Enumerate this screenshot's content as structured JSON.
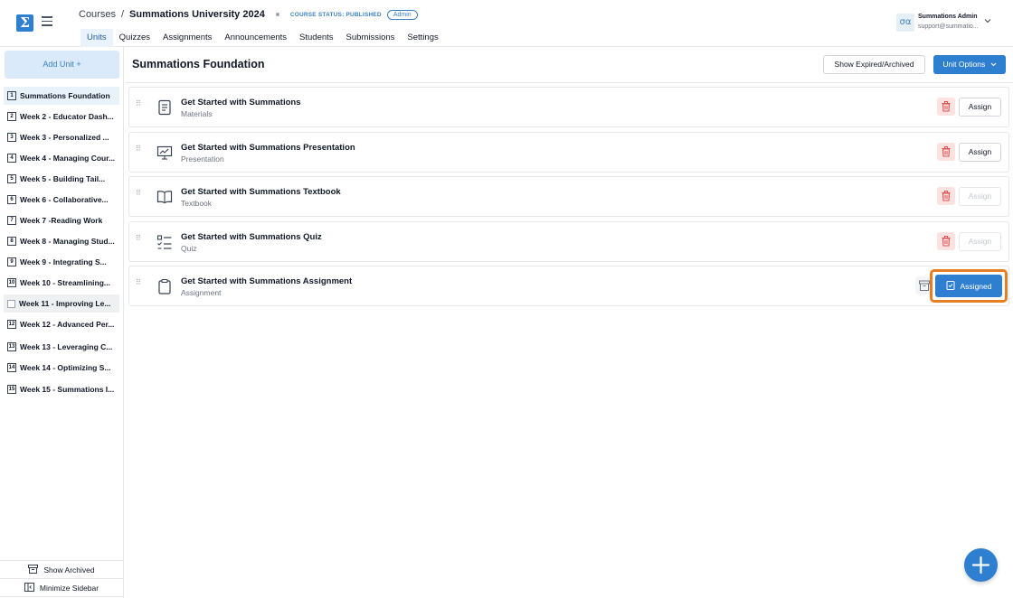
{
  "header": {
    "logo_glyph": "Σ",
    "breadcrumb": {
      "courses": "Courses",
      "separator": "/",
      "current": "Summations University 2024"
    },
    "course_status": "COURSE STATUS: PUBLISHED",
    "role_badge": "Admin",
    "tabs": [
      {
        "label": "Units",
        "active": true
      },
      {
        "label": "Quizzes",
        "active": false
      },
      {
        "label": "Assignments",
        "active": false
      },
      {
        "label": "Announcements",
        "active": false
      },
      {
        "label": "Students",
        "active": false
      },
      {
        "label": "Submissions",
        "active": false
      },
      {
        "label": "Settings",
        "active": false
      }
    ],
    "user": {
      "avatar_text": "σα",
      "name": "Summations Admin",
      "email": "support@summatio..."
    }
  },
  "sidebar": {
    "add_unit_label": "Add Unit +",
    "units": [
      {
        "num": "1",
        "label": "Summations Foundation"
      },
      {
        "num": "2",
        "label": "Week 2 - Educator Dash..."
      },
      {
        "num": "3",
        "label": "Week 3 - Personalized ..."
      },
      {
        "num": "4",
        "label": "Week 4 - Managing Cour..."
      },
      {
        "num": "5",
        "label": "Week 5 - Building Tail..."
      },
      {
        "num": "6",
        "label": "Week 6 - Collaborative..."
      },
      {
        "num": "7",
        "label": "Week 7 -Reading Work"
      },
      {
        "num": "8",
        "label": "Week 8 - Managing Stud..."
      },
      {
        "num": "9",
        "label": "Week 9 - Integrating S..."
      },
      {
        "num": "10",
        "label": "Week 10 - Streamlining..."
      },
      {
        "num": "",
        "label": "Week 11 - Improving Le..."
      },
      {
        "num": "12",
        "label": "Week 12 - Advanced Per..."
      },
      {
        "num": "13",
        "label": "Week 13 - Leveraging C..."
      },
      {
        "num": "14",
        "label": "Week 14 - Optimizing S..."
      },
      {
        "num": "15",
        "label": "Week 15 - Summations I..."
      }
    ],
    "show_archived_label": "Show Archived",
    "minimize_label": "Minimize Sidebar"
  },
  "main": {
    "title": "Summations Foundation",
    "show_expired_label": "Show Expired/Archived",
    "unit_options_label": "Unit Options",
    "items": [
      {
        "title": "Get Started with Summations",
        "type": "Materials",
        "icon": "document-icon",
        "action": "Assign"
      },
      {
        "title": "Get Started with Summations Presentation",
        "type": "Presentation",
        "icon": "presentation-icon",
        "action": "Assign"
      },
      {
        "title": "Get Started with Summations Textbook",
        "type": "Textbook",
        "icon": "book-icon",
        "action": "Assign"
      },
      {
        "title": "Get Started with Summations Quiz",
        "type": "Quiz",
        "icon": "quiz-list-icon",
        "action": "Assign"
      },
      {
        "title": "Get Started with Summations Assignment",
        "type": "Assignment",
        "icon": "clipboard-icon",
        "action": "Assigned"
      }
    ]
  },
  "colors": {
    "accent": "#2f7fd1",
    "highlight": "#e67e22",
    "danger_bg": "#fde2e2",
    "danger_icon": "#e05252"
  }
}
